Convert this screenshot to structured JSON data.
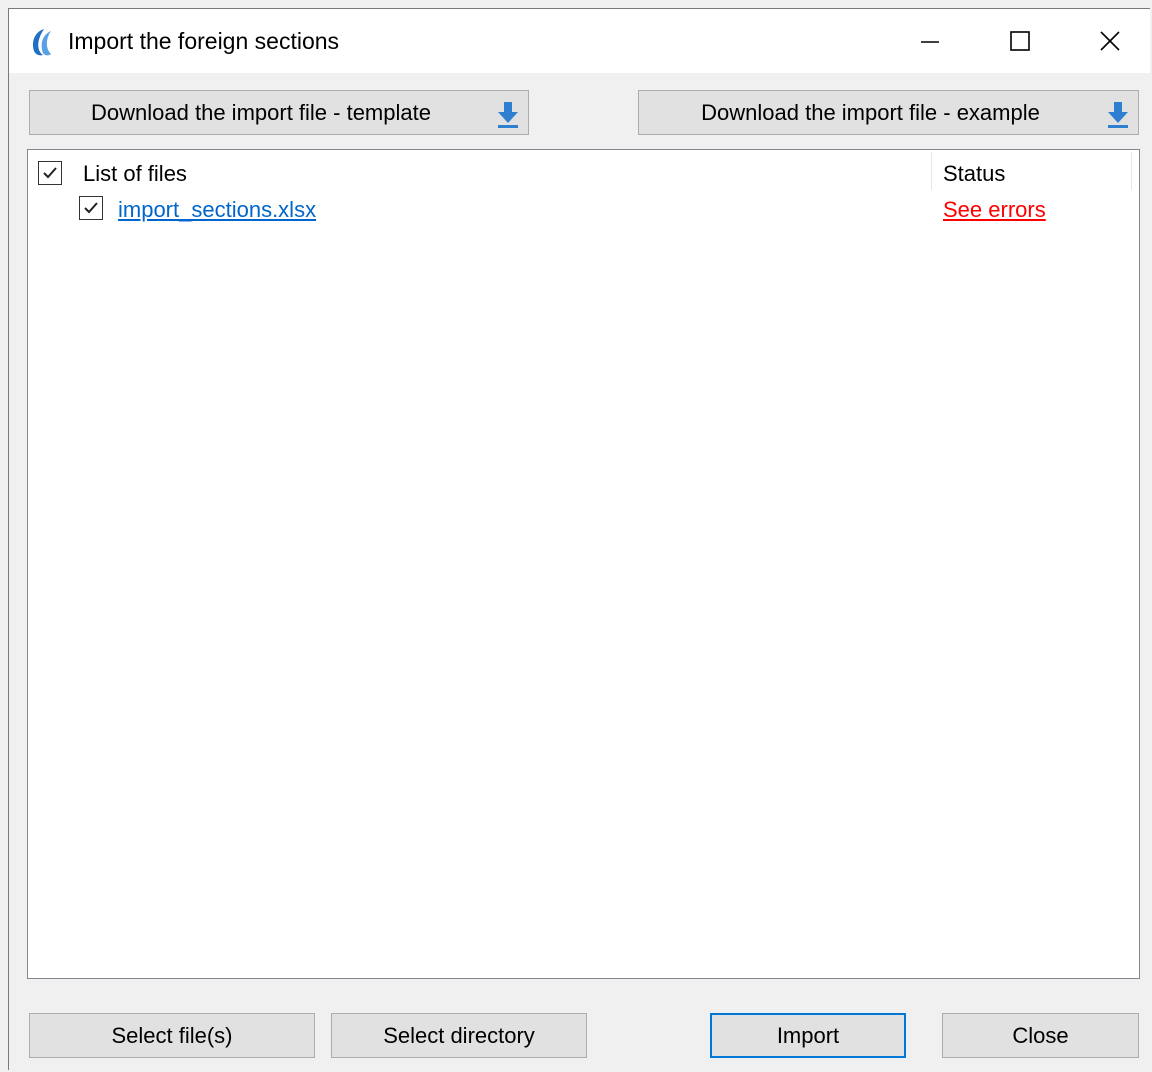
{
  "window": {
    "title": "Import the foreign sections",
    "icon": "app-logo-icon"
  },
  "toolbar": {
    "download_template_label": "Download the import file - template",
    "download_example_label": "Download the import file - example",
    "download_icon": "download-arrow-icon"
  },
  "file_list": {
    "header_name": "List of files",
    "header_status": "Status",
    "header_checked": true,
    "rows": [
      {
        "name": "import_sections.xlsx",
        "status": "See errors",
        "checked": true
      }
    ]
  },
  "footer": {
    "select_files_label": "Select file(s)",
    "select_directory_label": "Select directory",
    "import_label": "Import",
    "close_label": "Close"
  },
  "colors": {
    "link": "#0066cc",
    "error": "#ff0000",
    "accent": "#0078d7",
    "download_icon": "#2f7fd1"
  }
}
